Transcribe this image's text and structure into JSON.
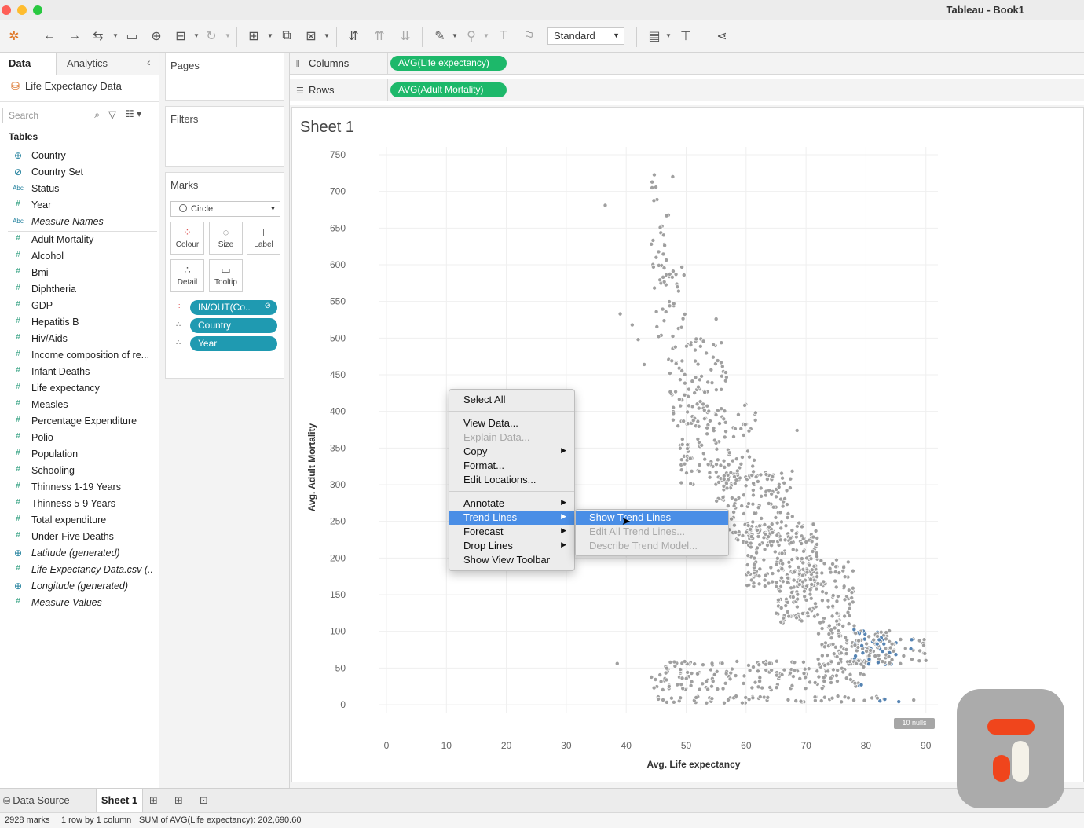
{
  "window": {
    "title": "Tableau - Book1"
  },
  "toolbar": {
    "fit_select": "Standard"
  },
  "data_panel": {
    "tab_data": "Data",
    "tab_analytics": "Analytics",
    "datasource": "Life Expectancy Data",
    "search_placeholder": "Search",
    "tables_heading": "Tables",
    "fields": [
      {
        "label": "Country",
        "type": "globe",
        "italic": false
      },
      {
        "label": "Country Set",
        "type": "set",
        "italic": false
      },
      {
        "label": "Status",
        "type": "abc",
        "italic": false
      },
      {
        "label": "Year",
        "type": "num",
        "italic": false
      },
      {
        "label": "Measure Names",
        "type": "abc",
        "italic": true
      },
      {
        "label": "Adult Mortality",
        "type": "num",
        "italic": false
      },
      {
        "label": "Alcohol",
        "type": "num",
        "italic": false
      },
      {
        "label": "Bmi",
        "type": "num",
        "italic": false
      },
      {
        "label": "Diphtheria",
        "type": "num",
        "italic": false
      },
      {
        "label": "GDP",
        "type": "num",
        "italic": false
      },
      {
        "label": "Hepatitis B",
        "type": "num",
        "italic": false
      },
      {
        "label": "Hiv/Aids",
        "type": "num",
        "italic": false
      },
      {
        "label": "Income composition of re...",
        "type": "num",
        "italic": false
      },
      {
        "label": "Infant Deaths",
        "type": "num",
        "italic": false
      },
      {
        "label": "Life expectancy",
        "type": "num",
        "italic": false
      },
      {
        "label": "Measles",
        "type": "num",
        "italic": false
      },
      {
        "label": "Percentage Expenditure",
        "type": "num",
        "italic": false
      },
      {
        "label": "Polio",
        "type": "num",
        "italic": false
      },
      {
        "label": "Population",
        "type": "num",
        "italic": false
      },
      {
        "label": "Schooling",
        "type": "num",
        "italic": false
      },
      {
        "label": "Thinness  1-19 Years",
        "type": "num",
        "italic": false
      },
      {
        "label": "Thinness 5-9 Years",
        "type": "num",
        "italic": false
      },
      {
        "label": "Total expenditure",
        "type": "num",
        "italic": false
      },
      {
        "label": "Under-Five Deaths",
        "type": "num",
        "italic": false
      },
      {
        "label": "Latitude (generated)",
        "type": "globe",
        "italic": true
      },
      {
        "label": "Life Expectancy Data.csv (...",
        "type": "num",
        "italic": true
      },
      {
        "label": "Longitude (generated)",
        "type": "globe",
        "italic": true
      },
      {
        "label": "Measure Values",
        "type": "num",
        "italic": true
      }
    ]
  },
  "cards": {
    "pages": "Pages",
    "filters": "Filters",
    "marks": "Marks",
    "mark_type": "Circle",
    "buttons": {
      "colour": "Colour",
      "size": "Size",
      "label": "Label",
      "detail": "Detail",
      "tooltip": "Tooltip"
    },
    "pills": [
      {
        "label": "IN/OUT(Co..",
        "kind": "colour"
      },
      {
        "label": "Country",
        "kind": "detail"
      },
      {
        "label": "Year",
        "kind": "detail"
      }
    ]
  },
  "shelves": {
    "columns_label": "Columns",
    "columns_pill": "AVG(Life expectancy)",
    "rows_label": "Rows",
    "rows_pill": "AVG(Adult Mortality)"
  },
  "sheet": {
    "title": "Sheet 1",
    "nulls": "10 nulls"
  },
  "context_menu": {
    "items": [
      {
        "label": "Select All",
        "disabled": false,
        "submenu": false
      },
      {
        "label": "View Data...",
        "disabled": false,
        "submenu": false
      },
      {
        "label": "Explain Data...",
        "disabled": true,
        "submenu": false
      },
      {
        "label": "Copy",
        "disabled": false,
        "submenu": true
      },
      {
        "label": "Format...",
        "disabled": false,
        "submenu": false
      },
      {
        "label": "Edit Locations...",
        "disabled": false,
        "submenu": false
      },
      {
        "label": "Annotate",
        "disabled": false,
        "submenu": true
      },
      {
        "label": "Trend Lines",
        "disabled": false,
        "submenu": true,
        "selected": true
      },
      {
        "label": "Forecast",
        "disabled": false,
        "submenu": true
      },
      {
        "label": "Drop Lines",
        "disabled": false,
        "submenu": true
      },
      {
        "label": "Show View Toolbar",
        "disabled": false,
        "submenu": false
      }
    ],
    "submenu": [
      {
        "label": "Show Trend Lines",
        "disabled": false,
        "selected": true
      },
      {
        "label": "Edit All Trend Lines...",
        "disabled": true
      },
      {
        "label": "Describe Trend Model...",
        "disabled": true
      }
    ]
  },
  "tabs": {
    "data_source": "Data Source",
    "sheet1": "Sheet 1"
  },
  "status": {
    "marks": "2928 marks",
    "rows_cols": "1 row by 1 column",
    "sum": "SUM of AVG(Life expectancy): 202,690.60"
  },
  "chart_data": {
    "type": "scatter",
    "xlabel": "Avg. Life expectancy",
    "ylabel": "Avg. Adult Mortality",
    "xlim": [
      0,
      92
    ],
    "ylim": [
      0,
      750
    ],
    "x_ticks": [
      0,
      10,
      20,
      30,
      40,
      50,
      60,
      70,
      80,
      90
    ],
    "y_ticks": [
      0,
      50,
      100,
      150,
      200,
      250,
      300,
      350,
      400,
      450,
      500,
      550,
      600,
      650,
      700,
      750
    ],
    "grid": true,
    "point_color": "#9b9b9b",
    "highlight_color": "#4f7fb0",
    "clusters": [
      {
        "x_range": [
          44,
          48
        ],
        "y_range": [
          560,
          725
        ],
        "count": 30
      },
      {
        "x_range": [
          45,
          50
        ],
        "y_range": [
          500,
          600
        ],
        "count": 30
      },
      {
        "x_range": [
          47,
          57
        ],
        "y_range": [
          380,
          500
        ],
        "count": 90
      },
      {
        "x_range": [
          49,
          62
        ],
        "y_range": [
          300,
          410
        ],
        "count": 120
      },
      {
        "x_range": [
          55,
          68
        ],
        "y_range": [
          220,
          320
        ],
        "count": 160
      },
      {
        "x_range": [
          60,
          72
        ],
        "y_range": [
          160,
          250
        ],
        "count": 170
      },
      {
        "x_range": [
          65,
          78
        ],
        "y_range": [
          110,
          200
        ],
        "count": 170
      },
      {
        "x_range": [
          72,
          84
        ],
        "y_range": [
          55,
          110
        ],
        "count": 130
      },
      {
        "x_range": [
          78,
          90
        ],
        "y_range": [
          55,
          90
        ],
        "count": 60
      },
      {
        "x_range": [
          44,
          80
        ],
        "y_range": [
          20,
          60
        ],
        "count": 180
      },
      {
        "x_range": [
          45,
          88
        ],
        "y_range": [
          2,
          12
        ],
        "count": 60
      }
    ],
    "outliers": [
      {
        "x": 36.5,
        "y": 681
      },
      {
        "x": 39,
        "y": 533
      },
      {
        "x": 41,
        "y": 518
      },
      {
        "x": 42,
        "y": 498
      },
      {
        "x": 43,
        "y": 464
      },
      {
        "x": 45,
        "y": 610
      },
      {
        "x": 55,
        "y": 526
      },
      {
        "x": 68.5,
        "y": 374
      },
      {
        "x": 38.5,
        "y": 56
      }
    ]
  }
}
